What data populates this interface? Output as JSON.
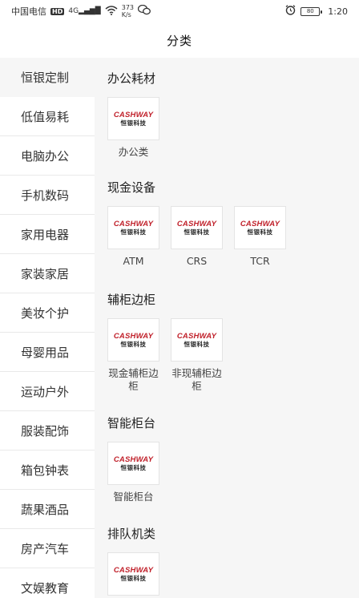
{
  "status_bar": {
    "carrier": "中国电信",
    "hd": "HD",
    "network": "4G",
    "speed_value": "373",
    "speed_unit": "K/s",
    "battery": "80",
    "time": "1:20"
  },
  "header": {
    "title": "分类"
  },
  "sidebar": {
    "items": [
      {
        "label": "恒银定制",
        "active": true
      },
      {
        "label": "低值易耗"
      },
      {
        "label": "电脑办公"
      },
      {
        "label": "手机数码"
      },
      {
        "label": "家用电器"
      },
      {
        "label": "家装家居"
      },
      {
        "label": "美妆个护"
      },
      {
        "label": "母婴用品"
      },
      {
        "label": "运动户外"
      },
      {
        "label": "服装配饰"
      },
      {
        "label": "箱包钟表"
      },
      {
        "label": "蔬果酒品"
      },
      {
        "label": "房产汽车"
      },
      {
        "label": "文娱教育"
      }
    ]
  },
  "logo": {
    "brand": "CASHWAY",
    "sub": "恒银科技"
  },
  "sections": [
    {
      "title": "办公耗材",
      "products": [
        "办公类"
      ]
    },
    {
      "title": "现金设备",
      "products": [
        "ATM",
        "CRS",
        "TCR"
      ]
    },
    {
      "title": "辅柜边柜",
      "products": [
        "现金辅柜边柜",
        "非现辅柜边柜"
      ]
    },
    {
      "title": "智能柜台",
      "products": [
        "智能柜台"
      ]
    },
    {
      "title": "排队机类",
      "products": [
        ""
      ]
    }
  ],
  "colors": {
    "brand_red": "#c0202a",
    "panel_bg": "#f6f6f6"
  }
}
